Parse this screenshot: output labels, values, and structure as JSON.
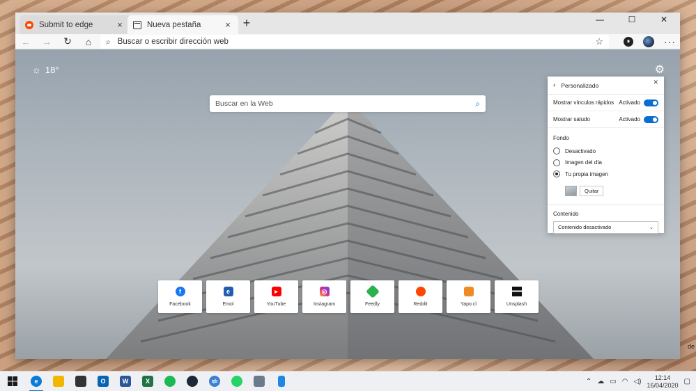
{
  "desktop": {
    "partial_label": "de"
  },
  "browser": {
    "tabs": [
      {
        "title": "Submit to edge",
        "close": "×",
        "icon": "reddit-icon"
      },
      {
        "title": "Nueva pestaña",
        "close": "×",
        "icon": "newtab-page-icon"
      }
    ],
    "new_tab": "+",
    "window_controls": {
      "minimize": "—",
      "maximize": "☐",
      "close": "✕"
    },
    "address_placeholder": "Buscar o escribir dirección web"
  },
  "newtab": {
    "weather": {
      "temp": "18°",
      "icon": "sun-icon"
    },
    "search_placeholder": "Buscar en la Web",
    "quick_links": [
      {
        "label": "Facebook",
        "icon": "facebook-icon",
        "color": "#1877f2",
        "glyph": "f"
      },
      {
        "label": "Emol",
        "icon": "emol-icon",
        "color": "#1f5fae",
        "glyph": "e"
      },
      {
        "label": "YouTube",
        "icon": "youtube-icon",
        "color": "#ff0000",
        "glyph": "▶"
      },
      {
        "label": "Instagram",
        "icon": "instagram-icon",
        "color": "#d6249f",
        "glyph": "◎"
      },
      {
        "label": "Feedly",
        "icon": "feedly-icon",
        "color": "#2bb24c",
        "glyph": "f"
      },
      {
        "label": "Reddit",
        "icon": "reddit-icon",
        "color": "#ff4500",
        "glyph": "●"
      },
      {
        "label": "Yapo.cl",
        "icon": "yapo-icon",
        "color": "#f08a24",
        "glyph": "◆"
      },
      {
        "label": "Unsplash",
        "icon": "unsplash-icon",
        "color": "#111111",
        "glyph": "▞"
      }
    ]
  },
  "panel": {
    "title": "Personalizado",
    "toggles": [
      {
        "label": "Mostrar vínculos rápidos",
        "state": "Activado"
      },
      {
        "label": "Mostrar saludo",
        "state": "Activado"
      }
    ],
    "background_label": "Fondo",
    "background_options": [
      {
        "label": "Desactivado",
        "checked": false
      },
      {
        "label": "Imagen del día",
        "checked": false
      },
      {
        "label": "Tu propia imagen",
        "checked": true
      }
    ],
    "remove_button": "Quitar",
    "content_label": "Contenido",
    "content_value": "Contenido desactivado"
  },
  "taskbar": {
    "apps": [
      {
        "name": "edge",
        "color": "#0c7bd6",
        "glyph": "e",
        "active": true
      },
      {
        "name": "file-explorer",
        "color": "#f2b600",
        "glyph": "▬"
      },
      {
        "name": "store",
        "color": "#333333",
        "glyph": "▦"
      },
      {
        "name": "outlook",
        "color": "#0a64b4",
        "glyph": "O"
      },
      {
        "name": "word",
        "color": "#2b579a",
        "glyph": "W"
      },
      {
        "name": "excel",
        "color": "#217346",
        "glyph": "X"
      },
      {
        "name": "spotify",
        "color": "#1db954",
        "glyph": "≋"
      },
      {
        "name": "steam",
        "color": "#1b2838",
        "glyph": "⚙"
      },
      {
        "name": "qbittorrent",
        "color": "#3c7fd1",
        "glyph": "qb"
      },
      {
        "name": "whatsapp",
        "color": "#25d366",
        "glyph": "✆"
      },
      {
        "name": "calculator",
        "color": "#6b7b8c",
        "glyph": "▤"
      },
      {
        "name": "phone",
        "color": "#1e88e5",
        "glyph": "▯"
      }
    ],
    "time": "12:14",
    "date": "16/04/2020"
  }
}
